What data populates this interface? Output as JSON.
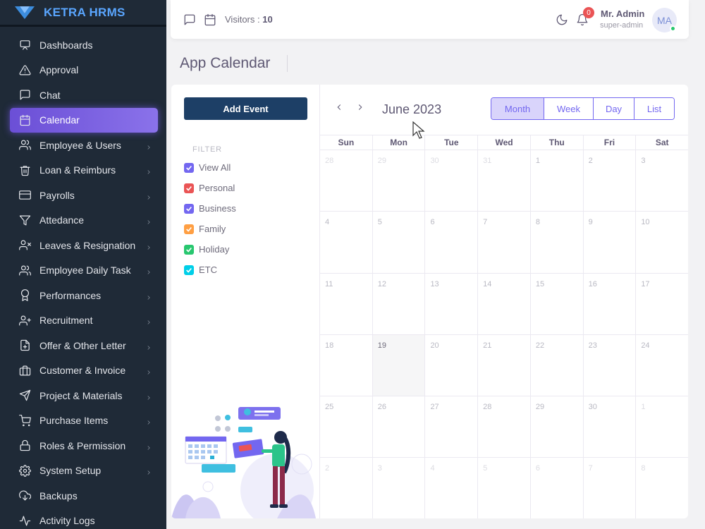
{
  "brand": {
    "name": "KETRA HRMS"
  },
  "sidebar": {
    "items": [
      {
        "label": "Dashboards",
        "icon": "monitor-icon",
        "chevron": false,
        "active": false
      },
      {
        "label": "Approval",
        "icon": "alert-triangle-icon",
        "chevron": false,
        "active": false
      },
      {
        "label": "Chat",
        "icon": "chat-icon",
        "chevron": false,
        "active": false
      },
      {
        "label": "Calendar",
        "icon": "calendar-icon",
        "chevron": false,
        "active": true
      },
      {
        "label": "Employee & Users",
        "icon": "users-icon",
        "chevron": true,
        "active": false
      },
      {
        "label": "Loan & Reimburs",
        "icon": "trash-icon",
        "chevron": true,
        "active": false
      },
      {
        "label": "Payrolls",
        "icon": "credit-card-icon",
        "chevron": true,
        "active": false
      },
      {
        "label": "Attedance",
        "icon": "filter-icon",
        "chevron": true,
        "active": false
      },
      {
        "label": "Leaves & Resignation",
        "icon": "user-x-icon",
        "chevron": true,
        "active": false
      },
      {
        "label": "Employee Daily Task",
        "icon": "users-icon",
        "chevron": true,
        "active": false
      },
      {
        "label": "Performances",
        "icon": "award-icon",
        "chevron": true,
        "active": false
      },
      {
        "label": "Recruitment",
        "icon": "user-plus-icon",
        "chevron": true,
        "active": false
      },
      {
        "label": "Offer & Other Letter",
        "icon": "file-plus-icon",
        "chevron": true,
        "active": false
      },
      {
        "label": "Customer & Invoice",
        "icon": "briefcase-icon",
        "chevron": true,
        "active": false
      },
      {
        "label": "Project & Materials",
        "icon": "send-icon",
        "chevron": true,
        "active": false
      },
      {
        "label": "Purchase Items",
        "icon": "shopping-cart-icon",
        "chevron": true,
        "active": false
      },
      {
        "label": "Roles & Permission",
        "icon": "lock-icon",
        "chevron": true,
        "active": false
      },
      {
        "label": "System Setup",
        "icon": "settings-icon",
        "chevron": true,
        "active": false
      },
      {
        "label": "Backups",
        "icon": "download-cloud-icon",
        "chevron": false,
        "active": false
      },
      {
        "label": "Activity Logs",
        "icon": "activity-icon",
        "chevron": false,
        "active": false
      }
    ]
  },
  "header": {
    "visitors_label": "Visitors : ",
    "visitors_count": "10",
    "notification_count": "0",
    "user_name": "Mr. Admin",
    "user_role": "super-admin",
    "avatar_initials": "MA"
  },
  "page": {
    "title": "App Calendar"
  },
  "left_panel": {
    "add_event_label": "Add Event",
    "filter_title": "FILTER",
    "filters": [
      {
        "label": "View All",
        "color": "#7367f0"
      },
      {
        "label": "Personal",
        "color": "#ea5455"
      },
      {
        "label": "Business",
        "color": "#7367f0"
      },
      {
        "label": "Family",
        "color": "#ff9f43"
      },
      {
        "label": "Holiday",
        "color": "#28c76f"
      },
      {
        "label": "ETC",
        "color": "#00cfe8"
      }
    ]
  },
  "calendar": {
    "title": "June 2023",
    "views": [
      {
        "label": "Month",
        "active": true
      },
      {
        "label": "Week",
        "active": false
      },
      {
        "label": "Day",
        "active": false
      },
      {
        "label": "List",
        "active": false
      }
    ],
    "weekdays": [
      "Sun",
      "Mon",
      "Tue",
      "Wed",
      "Thu",
      "Fri",
      "Sat"
    ],
    "weeks": [
      [
        {
          "d": "28",
          "o": true
        },
        {
          "d": "29",
          "o": true
        },
        {
          "d": "30",
          "o": true
        },
        {
          "d": "31",
          "o": true
        },
        {
          "d": "1"
        },
        {
          "d": "2"
        },
        {
          "d": "3"
        }
      ],
      [
        {
          "d": "4"
        },
        {
          "d": "5"
        },
        {
          "d": "6"
        },
        {
          "d": "7"
        },
        {
          "d": "8"
        },
        {
          "d": "9"
        },
        {
          "d": "10"
        }
      ],
      [
        {
          "d": "11"
        },
        {
          "d": "12"
        },
        {
          "d": "13"
        },
        {
          "d": "14"
        },
        {
          "d": "15"
        },
        {
          "d": "16"
        },
        {
          "d": "17"
        }
      ],
      [
        {
          "d": "18"
        },
        {
          "d": "19",
          "t": true
        },
        {
          "d": "20"
        },
        {
          "d": "21"
        },
        {
          "d": "22"
        },
        {
          "d": "23"
        },
        {
          "d": "24"
        }
      ],
      [
        {
          "d": "25"
        },
        {
          "d": "26"
        },
        {
          "d": "27"
        },
        {
          "d": "28"
        },
        {
          "d": "29"
        },
        {
          "d": "30"
        },
        {
          "d": "1",
          "o": true
        }
      ],
      [
        {
          "d": "2",
          "o": true
        },
        {
          "d": "3",
          "o": true
        },
        {
          "d": "4",
          "o": true
        },
        {
          "d": "5",
          "o": true
        },
        {
          "d": "6",
          "o": true
        },
        {
          "d": "7",
          "o": true
        },
        {
          "d": "8",
          "o": true
        }
      ]
    ]
  },
  "colors": {
    "sidebar_bg": "#1f2a37",
    "brand": "#5aa6ff",
    "accent": "#7367f0",
    "add_event_bg": "#1d3f66"
  }
}
